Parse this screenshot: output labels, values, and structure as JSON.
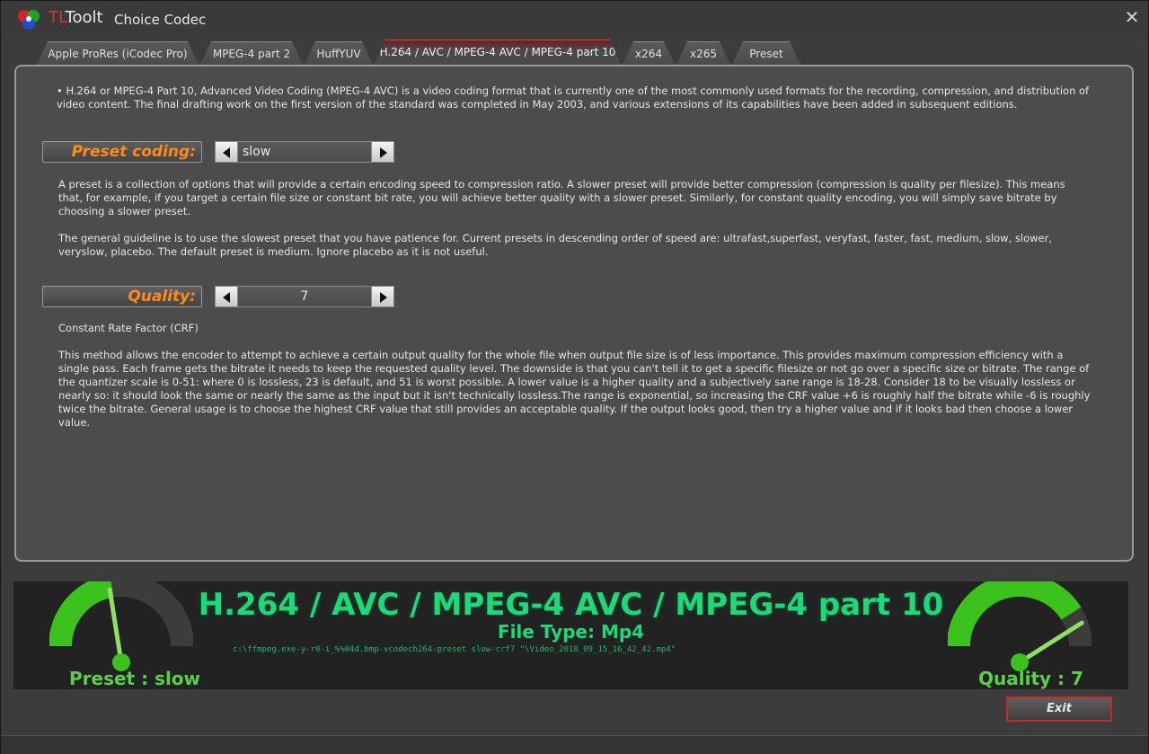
{
  "window": {
    "brand_prefix": "TL",
    "brand_suffix": "Toolt",
    "title": "Choice Codec",
    "close_label": "✕"
  },
  "tabs": [
    {
      "label": "Apple ProRes (iCodec Pro)",
      "active": false
    },
    {
      "label": "MPEG-4 part 2",
      "active": false
    },
    {
      "label": "HuffYUV",
      "active": false
    },
    {
      "label": "H.264 / AVC / MPEG-4 AVC / MPEG-4 part 10",
      "active": true
    },
    {
      "label": "x264",
      "active": false
    },
    {
      "label": "x265",
      "active": false
    },
    {
      "label": "Preset",
      "active": false
    }
  ],
  "main": {
    "intro": "• H.264 or MPEG-4 Part 10, Advanced Video Coding (MPEG-4 AVC) is a video coding format that is currently one of the most commonly used formats for the recording, compression, and distribution of video content. The final drafting work on the first version of the standard was completed in May 2003, and various extensions of its capabilities have been added in subsequent editions.",
    "preset": {
      "label": "Preset coding:",
      "value": "slow",
      "desc1": "A preset is a collection of options that will provide a certain encoding speed to compression ratio. A slower preset will provide better compression (compression is quality per  filesize). This means that, for example, if you target a certain file size or constant bit rate, you will achieve better quality with a slower preset. Similarly, for constant quality  encoding, you will simply save bitrate by choosing a slower preset.",
      "desc2": " The general guideline is to use the slowest preset that you have patience for. Current presets in descending order of speed are: ultrafast,superfast, veryfast, faster, fast, medium,  slow, slower, veryslow, placebo. The default preset is medium. Ignore placebo as it is not useful."
    },
    "quality": {
      "label": "Quality:",
      "value": "7",
      "subtitle": "Constant Rate Factor (CRF)",
      "desc": " This method allows the encoder to attempt to achieve a certain output quality for the whole file when output file size is of less importance. This provides maximum compression efficiency with a single pass. Each frame gets the bitrate it needs to keep the requested quality level. The downside is that you can't tell it to get a specific filesize or not go over a specific size or bitrate. The range of the quantizer scale is 0-51: where 0 is lossless, 23 is default, and 51 is worst possible. A lower value is a higher quality and a subjectively sane range is 18-28. Consider 18 to be visually lossless or nearly so: it should look the same or nearly the same as the input but it isn't technically lossless.The range is exponential, so increasing the CRF value +6 is roughly half the bitrate while -6 is roughly twice the bitrate. General usage is to choose the highest CRF value that still provides an acceptable quality. If the output looks good, then try a higher value and if it looks bad then choose a lower value."
    }
  },
  "summary": {
    "codec": "H.264 / AVC / MPEG-4 AVC / MPEG-4 part 10",
    "filetype": "File Type: Mp4",
    "command": "c:\\ffmpeg.exe-y-r0-i_%%04d.bmp-vcodech264-preset slow-crf7 \"\\Video_2018_09_15_16_42_42.mp4\"",
    "preset_gauge_label": "Preset : slow",
    "quality_gauge_label": "Quality : 7",
    "preset_gauge_level": 0.45,
    "quality_gauge_level": 0.82
  },
  "footer": {
    "exit_label": "Exit"
  },
  "colors": {
    "accent_orange": "#ff8a1c",
    "accent_green": "#1fd87a",
    "gauge_green": "#3cc21c",
    "active_tab": "#e04040"
  },
  "icons": {
    "logo": "rgb-circles-logo",
    "close": "close-icon",
    "left": "arrow-left-icon",
    "right": "arrow-right-icon"
  }
}
